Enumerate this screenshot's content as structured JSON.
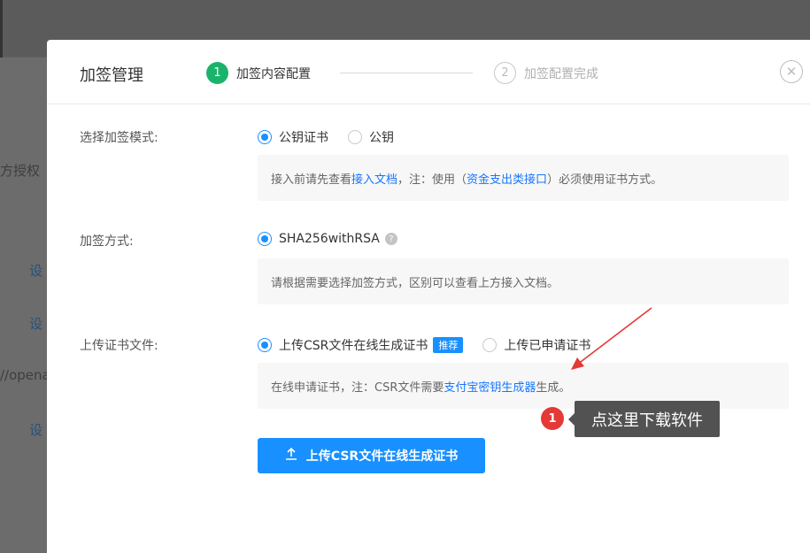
{
  "background": {
    "snippets": [
      "方授权",
      "设",
      "设",
      "//opena",
      "设"
    ]
  },
  "dialog": {
    "title": "加签管理",
    "steps": [
      {
        "num": "1",
        "label": "加签内容配置"
      },
      {
        "num": "2",
        "label": "加签配置完成"
      }
    ],
    "close_symbol": "✕"
  },
  "sign_mode": {
    "label": "选择加签模式:",
    "options": [
      "公钥证书",
      "公钥"
    ],
    "info_prefix": "接入前请先查看",
    "info_link1": "接入文档",
    "info_mid": "，注：使用（",
    "info_link2": "资金支出类接口",
    "info_suffix": "）必须使用证书方式。"
  },
  "sign_method": {
    "label": "加签方式:",
    "option": "SHA256withRSA",
    "help": "?",
    "info": "请根据需要选择加签方式，区别可以查看上方接入文档。"
  },
  "upload_cert": {
    "label": "上传证书文件:",
    "options": [
      "上传CSR文件在线生成证书",
      "上传已申请证书"
    ],
    "badge": "推荐",
    "info_prefix": "在线申请证书，注：CSR文件需要",
    "info_link": "支付宝密钥生成器",
    "info_suffix": "生成。",
    "button_label": "上传CSR文件在线生成证书"
  },
  "annotation": {
    "number": "1",
    "text": "点这里下载软件",
    "color": "#e53935"
  },
  "colors": {
    "primary": "#1890ff",
    "success": "#1ab36b"
  }
}
